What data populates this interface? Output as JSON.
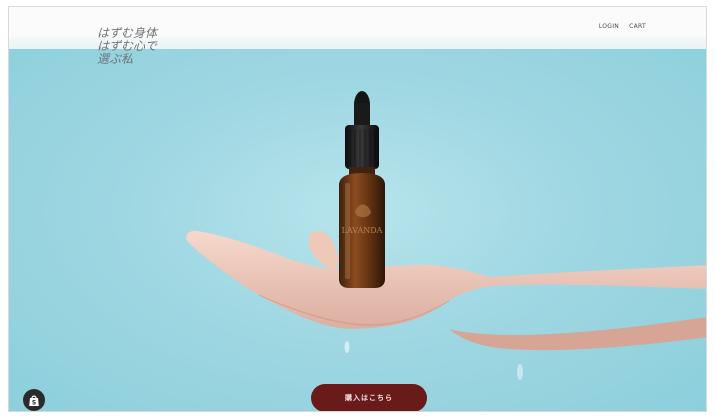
{
  "header": {
    "tagline_lines": [
      "はずむ身体",
      "はずむ心で",
      "選ぶ私"
    ],
    "nav": {
      "login": "LOGIN",
      "cart": "CART"
    }
  },
  "hero": {
    "background_color": "#9fd7e2",
    "product": "dropper-bottle",
    "bottle_label": "LAVANDA",
    "cta_label": "購入はこちら",
    "cta_color": "#6a1a19"
  },
  "store_badge": {
    "icon": "shopping-bag-icon"
  }
}
